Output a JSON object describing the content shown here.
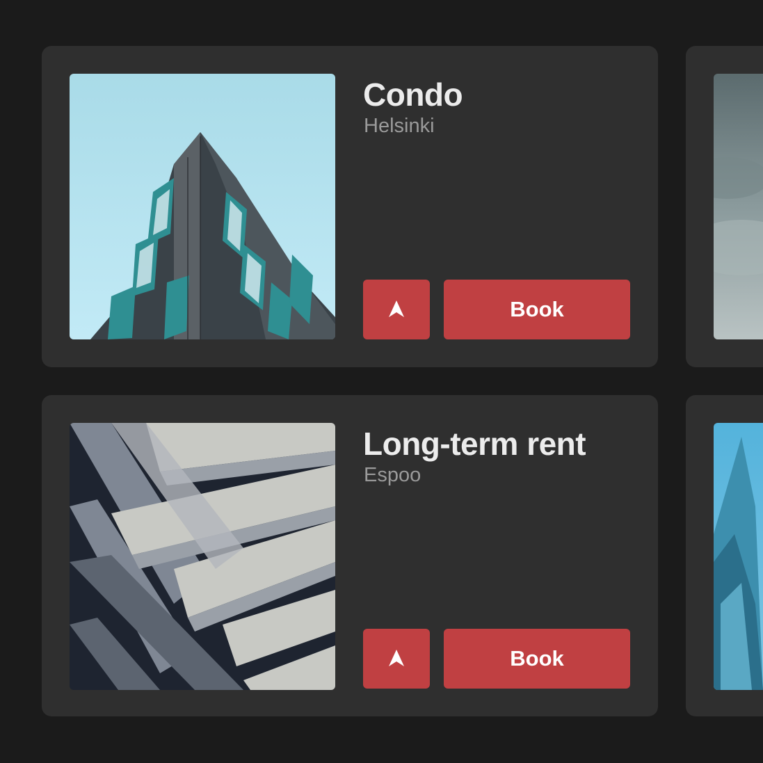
{
  "listings": [
    {
      "title": "Condo",
      "location": "Helsinki",
      "book_label": "Book",
      "nav_icon": "navigation-arrow-icon",
      "image": "building-photo"
    },
    {
      "title": "Long-term rent",
      "location": "Espoo",
      "book_label": "Book",
      "nav_icon": "navigation-arrow-icon",
      "image": "building-photo"
    }
  ],
  "colors": {
    "background": "#1b1b1b",
    "card": "#2f2f2f",
    "accent": "#c04042",
    "title": "#ececec",
    "subtitle": "#9a9a9a"
  }
}
